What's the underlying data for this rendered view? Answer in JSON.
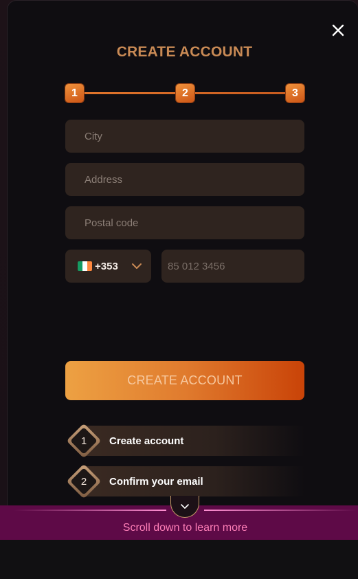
{
  "modal": {
    "title": "CREATE ACCOUNT",
    "close_icon": "close-icon"
  },
  "stepper": {
    "steps": [
      "1",
      "2",
      "3"
    ],
    "accent": "#e0762c"
  },
  "form": {
    "city_placeholder": "City",
    "address_placeholder": "Address",
    "postal_placeholder": "Postal code",
    "phone_country_flag": "ireland-flag-icon",
    "phone_code": "+353",
    "phone_placeholder": "85 012 3456"
  },
  "submit": {
    "label": "CREATE ACCOUNT"
  },
  "info_steps": [
    {
      "number": "1",
      "label": "Create account"
    },
    {
      "number": "2",
      "label": "Confirm your email"
    }
  ],
  "scroll_hint": {
    "text": "Scroll down to learn more",
    "color": "#ff7fb8",
    "background": "#5e0a47"
  }
}
